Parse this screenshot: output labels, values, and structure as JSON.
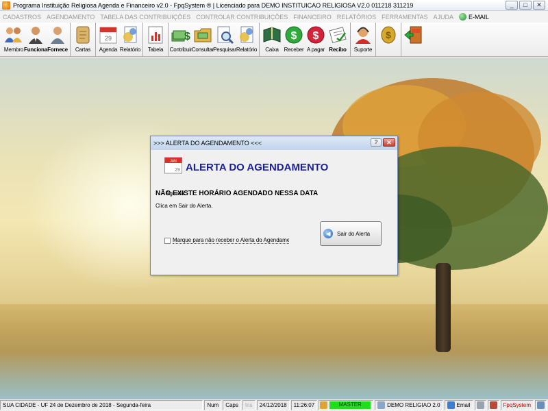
{
  "window": {
    "title": "Programa Instituição Religiosa Agenda e Financeiro v2.0 - FpqSystem ® | Licenciado para  DEMO INSTITUICAO RELIGIOSA V2.0 011218 311219",
    "controls": {
      "minimize": "_",
      "maximize": "□",
      "close": "✕"
    }
  },
  "menu": [
    {
      "label": "CADASTROS",
      "active": false
    },
    {
      "label": "AGENDAMENTO",
      "active": false
    },
    {
      "label": "TABELA DAS CONTRIBUIÇÕES",
      "active": false
    },
    {
      "label": "CONTROLAR CONTRIBUIÇÕES",
      "active": false
    },
    {
      "label": "FINANCEIRO",
      "active": false
    },
    {
      "label": "RELATÓRIOS",
      "active": false
    },
    {
      "label": "FERRAMENTAS",
      "active": false
    },
    {
      "label": "AJUDA",
      "active": false
    },
    {
      "label": "E-MAIL",
      "active": true,
      "icon": "globe-icon"
    }
  ],
  "toolbar": {
    "groups": [
      [
        {
          "label": "Membro",
          "icon": "people-icon"
        },
        {
          "label": "Funciona",
          "icon": "employee-icon",
          "bold": true
        },
        {
          "label": "Fornece",
          "icon": "supplier-icon",
          "bold": true
        }
      ],
      [
        {
          "label": "Cartas",
          "icon": "scroll-icon"
        }
      ],
      [
        {
          "label": "Agenda",
          "icon": "calendar-icon"
        },
        {
          "label": "Relatório",
          "icon": "report-icon"
        }
      ],
      [
        {
          "label": "Tabela",
          "icon": "table-chart-icon"
        }
      ],
      [
        {
          "label": "Contribuir",
          "icon": "money-stack-icon"
        },
        {
          "label": "Consultar",
          "icon": "folder-money-icon"
        },
        {
          "label": "Pesquisar",
          "icon": "magnifier-doc-icon"
        },
        {
          "label": "Relatório",
          "icon": "report-icon"
        }
      ],
      [
        {
          "label": "Caixa",
          "icon": "book-icon"
        },
        {
          "label": "Receber",
          "icon": "dollar-green-icon"
        },
        {
          "label": "A pagar",
          "icon": "dollar-red-icon"
        },
        {
          "label": "Recibo",
          "icon": "receipt-icon",
          "bold": true
        }
      ],
      [
        {
          "label": "Suporte",
          "icon": "support-icon"
        }
      ],
      [
        {
          "label": "",
          "icon": "coins-icon"
        }
      ],
      [
        {
          "label": "",
          "icon": "exit-icon"
        }
      ]
    ]
  },
  "dialog": {
    "title": ">>> ALERTA DO AGENDAMENTO <<<",
    "help_label": "?",
    "close_label": "✕",
    "icon_caption": "Agenda",
    "heading": "ALERTA DO AGENDAMENTO",
    "message": "NÃO EXISTE HORÁRIO AGENDADO NESSA DATA",
    "submessage": "Clica em Sair do Alerta.",
    "exit_button": "Sair do Alerta",
    "checkbox_label": "Marque para não receber o Alerta do Agendamento para ess",
    "checkbox_checked": false,
    "calendar_month": "JAN",
    "calendar_day": "29"
  },
  "statusbar": {
    "city": "SUA CIDADE - UF 24 de Dezembro de 2018 - Segunda-feira",
    "num": "Num",
    "caps": "Caps",
    "ins": "Ins",
    "date": "24/12/2018",
    "time": "11:26:07",
    "user": "MASTER",
    "version": "DEMO RELIGIAO 2.0",
    "email": "Email",
    "brand": "FpqSystem"
  },
  "colors": {
    "heading": "#1a1f9a",
    "master_bg": "#22dc22",
    "brand_text": "#c00000"
  }
}
